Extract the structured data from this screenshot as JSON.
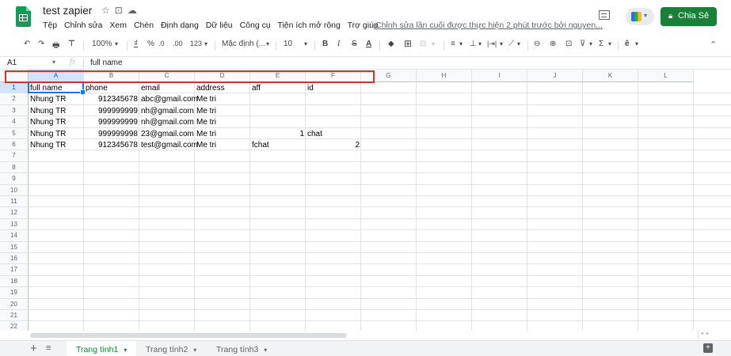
{
  "app": {
    "doc_title": "test zapier",
    "title_icons": [
      "star-icon",
      "move-icon",
      "cloud-status-icon"
    ],
    "menu": [
      "Tệp",
      "Chỉnh sửa",
      "Xem",
      "Chèn",
      "Định dạng",
      "Dữ liệu",
      "Công cụ",
      "Tiện ích mở rộng",
      "Trợ giúp"
    ],
    "last_edit": "Chỉnh sửa lần cuối được thực hiện 2 phút trước bởi nguyen...",
    "share_label": "Chia Sẻ",
    "brand_color": "#188038"
  },
  "toolbar": {
    "undo": "↶",
    "redo": "↷",
    "print": "🖶",
    "paint_format": "⊤",
    "zoom": "100%",
    "currency": "₫",
    "percent": "%",
    "dec_decrease": ".0",
    "dec_increase": ".00",
    "more_formats": "123",
    "font": "Mặc định (...",
    "font_size": "10",
    "bold": "B",
    "italic": "I",
    "strike": "S",
    "text_color": "A",
    "fill": "◆",
    "borders": "⊞",
    "merge": "⊟",
    "halign": "≡",
    "valign": "⊥",
    "wrap": "|⇥|",
    "rotate": "⟋",
    "link": "⊖",
    "comment": "⊕",
    "chart": "⊡",
    "filter": "⊽",
    "functions": "Σ",
    "input_tools": "ê",
    "collapse": "⌃"
  },
  "formula_bar": {
    "name_box": "A1",
    "fx": "fx",
    "value": "full name"
  },
  "grid": {
    "columns": [
      "A",
      "B",
      "C",
      "D",
      "E",
      "F",
      "G",
      "H",
      "I",
      "J",
      "K",
      "L"
    ],
    "rows": [
      "1",
      "2",
      "3",
      "4",
      "5",
      "6",
      "7",
      "8",
      "9",
      "10",
      "11",
      "12",
      "13",
      "14",
      "15",
      "16",
      "17",
      "18",
      "19",
      "20",
      "21",
      "22"
    ],
    "cells": {
      "r1": [
        "full name",
        "phone",
        "email",
        "address",
        "aff",
        "id"
      ],
      "r2": [
        "Nhung TR",
        "912345678",
        "abc@gmail.com",
        "Me tri",
        "",
        ""
      ],
      "r3": [
        "Nhung TR",
        "999999999",
        "nh@gmail.com",
        "Me tri",
        "",
        ""
      ],
      "r4": [
        "Nhung TR",
        "999999999",
        "nh@gmail.com",
        "Me tri",
        "",
        ""
      ],
      "r5": [
        "Nhung TR",
        "999999998",
        "23@gmail.com",
        "Me tri",
        "1",
        "chat"
      ],
      "r6": [
        "Nhung TR",
        "912345678",
        "test@gmail.com",
        "Me tri",
        "fchat",
        "2"
      ]
    }
  },
  "sheets": {
    "tabs": [
      "Trang tính1",
      "Trang tính2",
      "Trang tính3"
    ],
    "active": "Trang tính1",
    "caret": "▾",
    "add": "+",
    "all": "≡",
    "explore": "+"
  },
  "colors": {
    "highlight_border": "#d93025",
    "selection": "#1a73e8"
  }
}
